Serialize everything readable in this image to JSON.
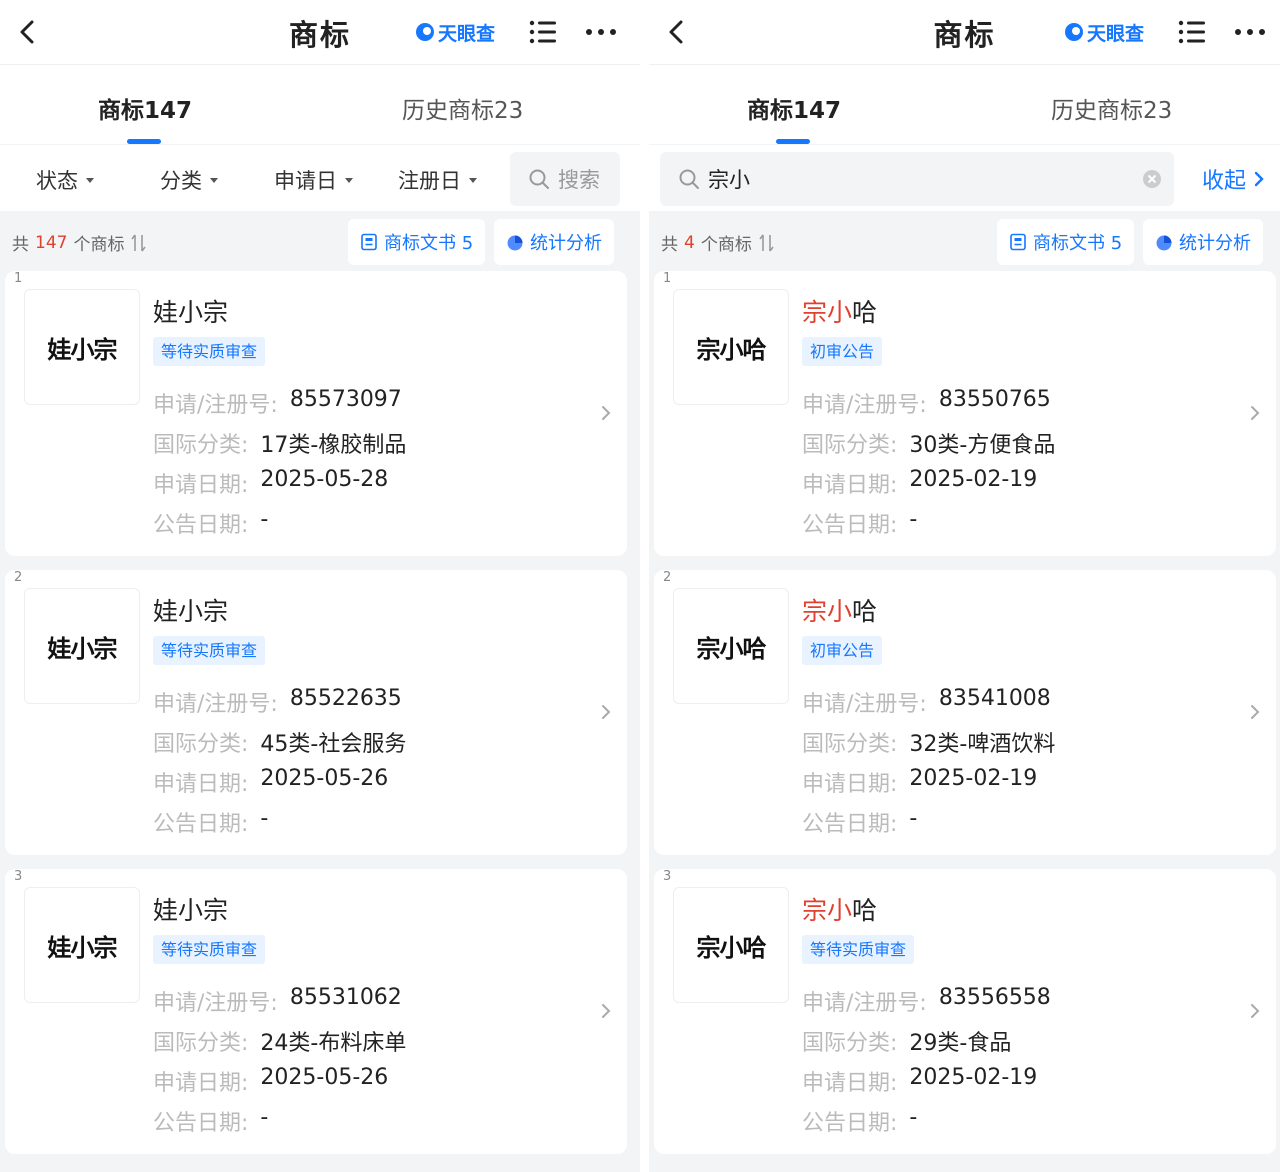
{
  "left": {
    "title": "商标",
    "brand": "天眼查",
    "tabs": [
      {
        "label": "商标147"
      },
      {
        "label": "历史商标23"
      }
    ],
    "filters": [
      {
        "label": "状态"
      },
      {
        "label": "分类"
      },
      {
        "label": "申请日"
      },
      {
        "label": "注册日"
      }
    ],
    "search_placeholder": "搜索",
    "summary": {
      "prefix": "共",
      "count": "147",
      "suffix": "个商标"
    },
    "doc_pill": "商标文书 5",
    "stats_pill": "统计分析",
    "labels": {
      "reg_no": "申请/注册号:",
      "category": "国际分类:",
      "apply_date": "申请日期:",
      "announce_date": "公告日期:"
    },
    "cards": [
      {
        "index": "1",
        "logo": "娃小宗",
        "name_hl": "",
        "name_rest": "娃小宗",
        "status": "等待实质审查",
        "reg_no": "85573097",
        "category": "17类-橡胶制品",
        "apply_date": "2025-05-28",
        "announce_date": "-"
      },
      {
        "index": "2",
        "logo": "娃小宗",
        "name_hl": "",
        "name_rest": "娃小宗",
        "status": "等待实质审查",
        "reg_no": "85522635",
        "category": "45类-社会服务",
        "apply_date": "2025-05-26",
        "announce_date": "-"
      },
      {
        "index": "3",
        "logo": "娃小宗",
        "name_hl": "",
        "name_rest": "娃小宗",
        "status": "等待实质审查",
        "reg_no": "85531062",
        "category": "24类-布料床单",
        "apply_date": "2025-05-26",
        "announce_date": "-"
      }
    ]
  },
  "right": {
    "title": "商标",
    "brand": "天眼查",
    "tabs": [
      {
        "label": "商标147"
      },
      {
        "label": "历史商标23"
      }
    ],
    "search_value": "宗小",
    "collapse_label": "收起",
    "summary": {
      "prefix": "共",
      "count": "4",
      "suffix": "个商标"
    },
    "doc_pill": "商标文书 5",
    "stats_pill": "统计分析",
    "labels": {
      "reg_no": "申请/注册号:",
      "category": "国际分类:",
      "apply_date": "申请日期:",
      "announce_date": "公告日期:"
    },
    "cards": [
      {
        "index": "1",
        "logo": "宗小哈",
        "name_hl": "宗小",
        "name_rest": "哈",
        "status": "初审公告",
        "reg_no": "83550765",
        "category": "30类-方便食品",
        "apply_date": "2025-02-19",
        "announce_date": "-"
      },
      {
        "index": "2",
        "logo": "宗小哈",
        "name_hl": "宗小",
        "name_rest": "哈",
        "status": "初审公告",
        "reg_no": "83541008",
        "category": "32类-啤酒饮料",
        "apply_date": "2025-02-19",
        "announce_date": "-"
      },
      {
        "index": "3",
        "logo": "宗小哈",
        "name_hl": "宗小",
        "name_rest": "哈",
        "status": "等待实质审查",
        "reg_no": "83556558",
        "category": "29类-食品",
        "apply_date": "2025-02-19",
        "announce_date": "-"
      }
    ]
  },
  "colors": {
    "accent": "#1677ff",
    "highlight": "#e0402e",
    "badge_bg": "#e8f3ff"
  },
  "icons": [
    "back-icon",
    "tianyancha-logo-icon",
    "list-menu-icon",
    "more-icon",
    "search-icon",
    "clear-icon",
    "sort-icon",
    "document-icon",
    "stats-icon",
    "chevron-right-icon"
  ]
}
